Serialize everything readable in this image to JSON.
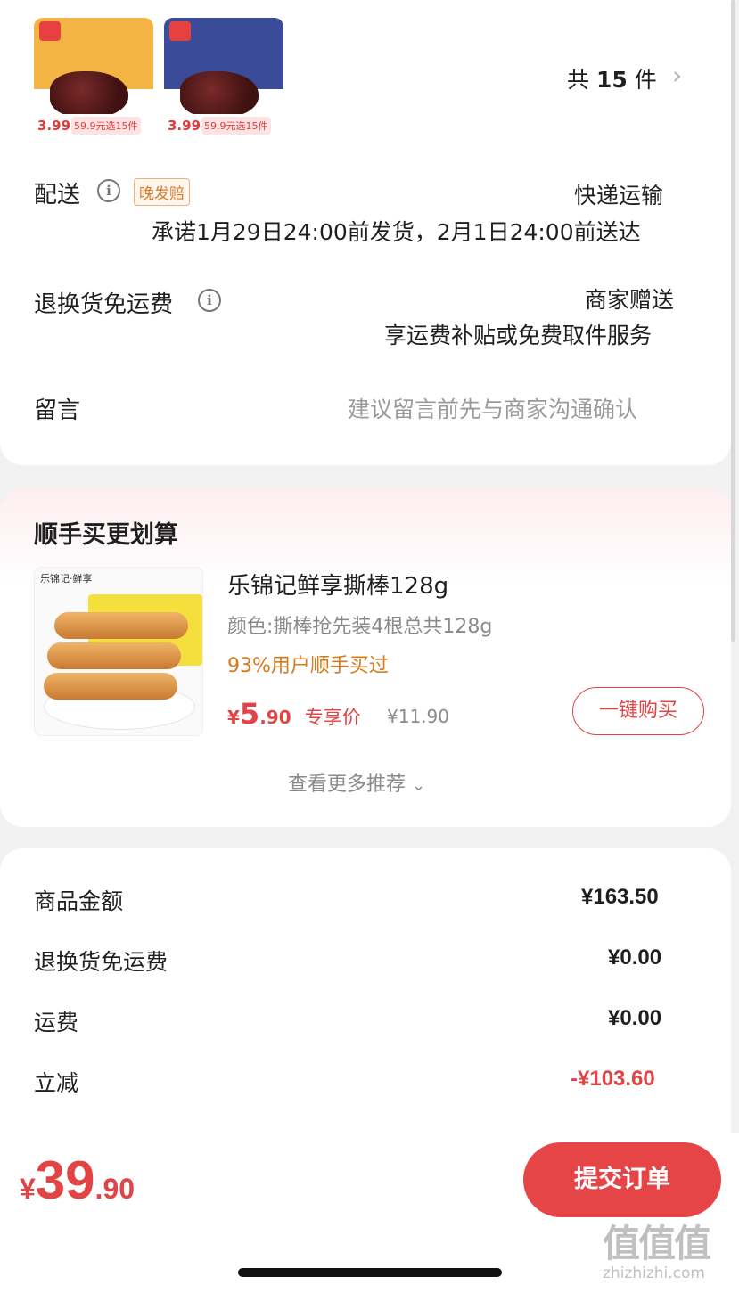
{
  "products": {
    "thumbs": [
      {
        "price": "3.99",
        "promo": "59.9元选15件",
        "bg": "#f3b443"
      },
      {
        "price": "3.99",
        "promo": "59.9元选15件",
        "bg": "#3a4b9a"
      }
    ],
    "count_prefix": "共",
    "count": "15",
    "count_suffix": "件"
  },
  "delivery": {
    "label": "配送",
    "badge": "晚发赔",
    "method": "快递运输",
    "promise": "承诺1月29日24:00前发货，2月1日24:00前送达"
  },
  "return_shipping": {
    "label": "退换货免运费",
    "value": "商家赠送",
    "sub": "享运费补贴或免费取件服务"
  },
  "message": {
    "label": "留言",
    "placeholder": "建议留言前先与商家沟通确认"
  },
  "recommend": {
    "title": "顺手买更划算",
    "product_name": "乐锦记鲜享撕棒128g",
    "spec": "颜色:撕棒抢先装4根总共128g",
    "popularity": "93%用户顺手买过",
    "currency": "¥",
    "price_int": "5",
    "price_dec": ".90",
    "price_tag": "专享价",
    "orig_price": "¥11.90",
    "buy_label": "一键购买",
    "more_label": "查看更多推荐"
  },
  "summary": {
    "rows": [
      {
        "label": "商品金额",
        "value": "¥163.50"
      },
      {
        "label": "退换货免运费",
        "value": "¥0.00"
      },
      {
        "label": "运费",
        "value": "¥0.00"
      },
      {
        "label": "立减",
        "value": "-¥103.60"
      }
    ]
  },
  "footer": {
    "currency": "¥",
    "total_int": "39",
    "total_dec": ".90",
    "submit_label": "提交订单"
  },
  "watermark": {
    "brand": "值值值",
    "url": "zhizhizhi.com"
  },
  "colors": {
    "accent": "#e64547",
    "text": "#1f1f1f",
    "muted": "#8a8a8a",
    "orange": "#d67a1e"
  }
}
